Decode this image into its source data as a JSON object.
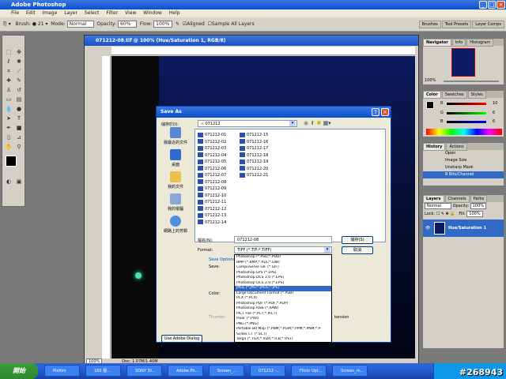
{
  "app": {
    "title": "Adobe Photoshop"
  },
  "menu": [
    "File",
    "Edit",
    "Image",
    "Layer",
    "Select",
    "Filter",
    "View",
    "Window",
    "Help"
  ],
  "options": {
    "brush_label": "Brush:",
    "brush_size": "21",
    "mode_label": "Mode:",
    "mode_value": "Normal",
    "opacity_label": "Opacity:",
    "opacity_value": "60%",
    "flow_label": "Flow:",
    "flow_value": "100%",
    "aligned_label": "Aligned",
    "sample_label": "Sample All Layers"
  },
  "workspace_tabs": [
    "Brushes",
    "Tool Presets",
    "Layer Comps"
  ],
  "document": {
    "title": "071212-08.tif @ 100% (Hue/Saturation 1, RGB/8)",
    "status_zoom": "100%",
    "status_doc": "Doc: 1.07M/1.40M"
  },
  "navigator": {
    "tabs": [
      "Navigator",
      "Info",
      "Histogram"
    ],
    "zoom": "100%"
  },
  "color_panel": {
    "tabs": [
      "Color",
      "Swatches",
      "Styles"
    ],
    "r_label": "R",
    "r_value": "10",
    "g_label": "G",
    "g_value": "6",
    "b_label": "B",
    "b_value": "6"
  },
  "history": {
    "tabs": [
      "History",
      "Actions"
    ],
    "items": [
      "Open",
      "Image Size",
      "Unsharp Mask",
      "8 Bits/Channel"
    ]
  },
  "layers": {
    "tabs": [
      "Layers",
      "Channels",
      "Paths"
    ],
    "blend": "Normal",
    "opacity_label": "Opacity:",
    "opacity_value": "100%",
    "lock_label": "Lock:",
    "fill_label": "Fill:",
    "fill_value": "100%",
    "layer_name": "Hue/Saturation 1"
  },
  "dialog": {
    "title": "Save As",
    "save_in_label": "儲存於(I):",
    "save_in_value": "071212",
    "places": [
      "我最近的文件",
      "桌面",
      "我的文件",
      "我的電腦",
      "網路上的芳鄰"
    ],
    "files_col1": [
      "071212-01",
      "071212-02",
      "071212-03",
      "071212-04",
      "071212-05",
      "071212-06",
      "071212-07",
      "071212-08",
      "071212-09",
      "071212-10",
      "071212-11",
      "071212-12",
      "071212-13",
      "071212-14"
    ],
    "files_col2": [
      "071212-15",
      "071212-16",
      "071212-17",
      "071212-18",
      "071212-19",
      "071212-20",
      "071212-21"
    ],
    "filename_label": "檔名(N):",
    "filename_value": "071212-08",
    "format_label": "Format:",
    "format_value": "TIFF (*.TIF;*.TIFF)",
    "save_button": "儲存(S)",
    "cancel_button": "取消",
    "save_options_label": "Save Options",
    "save_label": "Save:",
    "color_label": "Color:",
    "thumbnail_label": "Thumbn",
    "extension_label": "tension",
    "adobe_dialog_button": "Use Adobe Dialog",
    "format_options": [
      "Photoshop (*.PSD;*.PDD)",
      "BMP (*.BMP;*.RLE;*.DIB)",
      "CompuServe GIF (*.GIF)",
      "Photoshop EPS (*.EPS)",
      "Photoshop DCS 1.0 (*.EPS)",
      "Photoshop DCS 2.0 (*.EPS)",
      "JPEG (*.JPG;*.JPEG;*.JPE)",
      "Large Document Format (*.PSB)",
      "PCX (*.PCX)",
      "Photoshop PDF (*.PDF;*.PDP)",
      "Photoshop Raw (*.RAW)",
      "PICT File (*.PCT;*.PICT)",
      "Pixar (*.PXR)",
      "PNG (*.PNG)",
      "Portable Bit Map (*.PBM;*.PGM;*.PPM;*.PNM;*.P",
      "Scitex CT (*.SCT)",
      "Targa (*.TGA;*.VDA;*.ICB;*.VST)",
      "TIFF (*.TIF;*.TIFF)"
    ],
    "selected_index": 6
  },
  "taskbar": {
    "start": "開始",
    "tasks": [
      "Pixfilm",
      "165 個...",
      "SONY DI...",
      "Adobe Ph...",
      "Screen_...",
      "071212 -...",
      "Flickr Upl...",
      "Screen_m..."
    ],
    "time": "#268943"
  },
  "colors": {
    "xp_blue": "#0a4fcb",
    "dialog_bg": "#ece9d8",
    "selection": "#316ac5"
  }
}
